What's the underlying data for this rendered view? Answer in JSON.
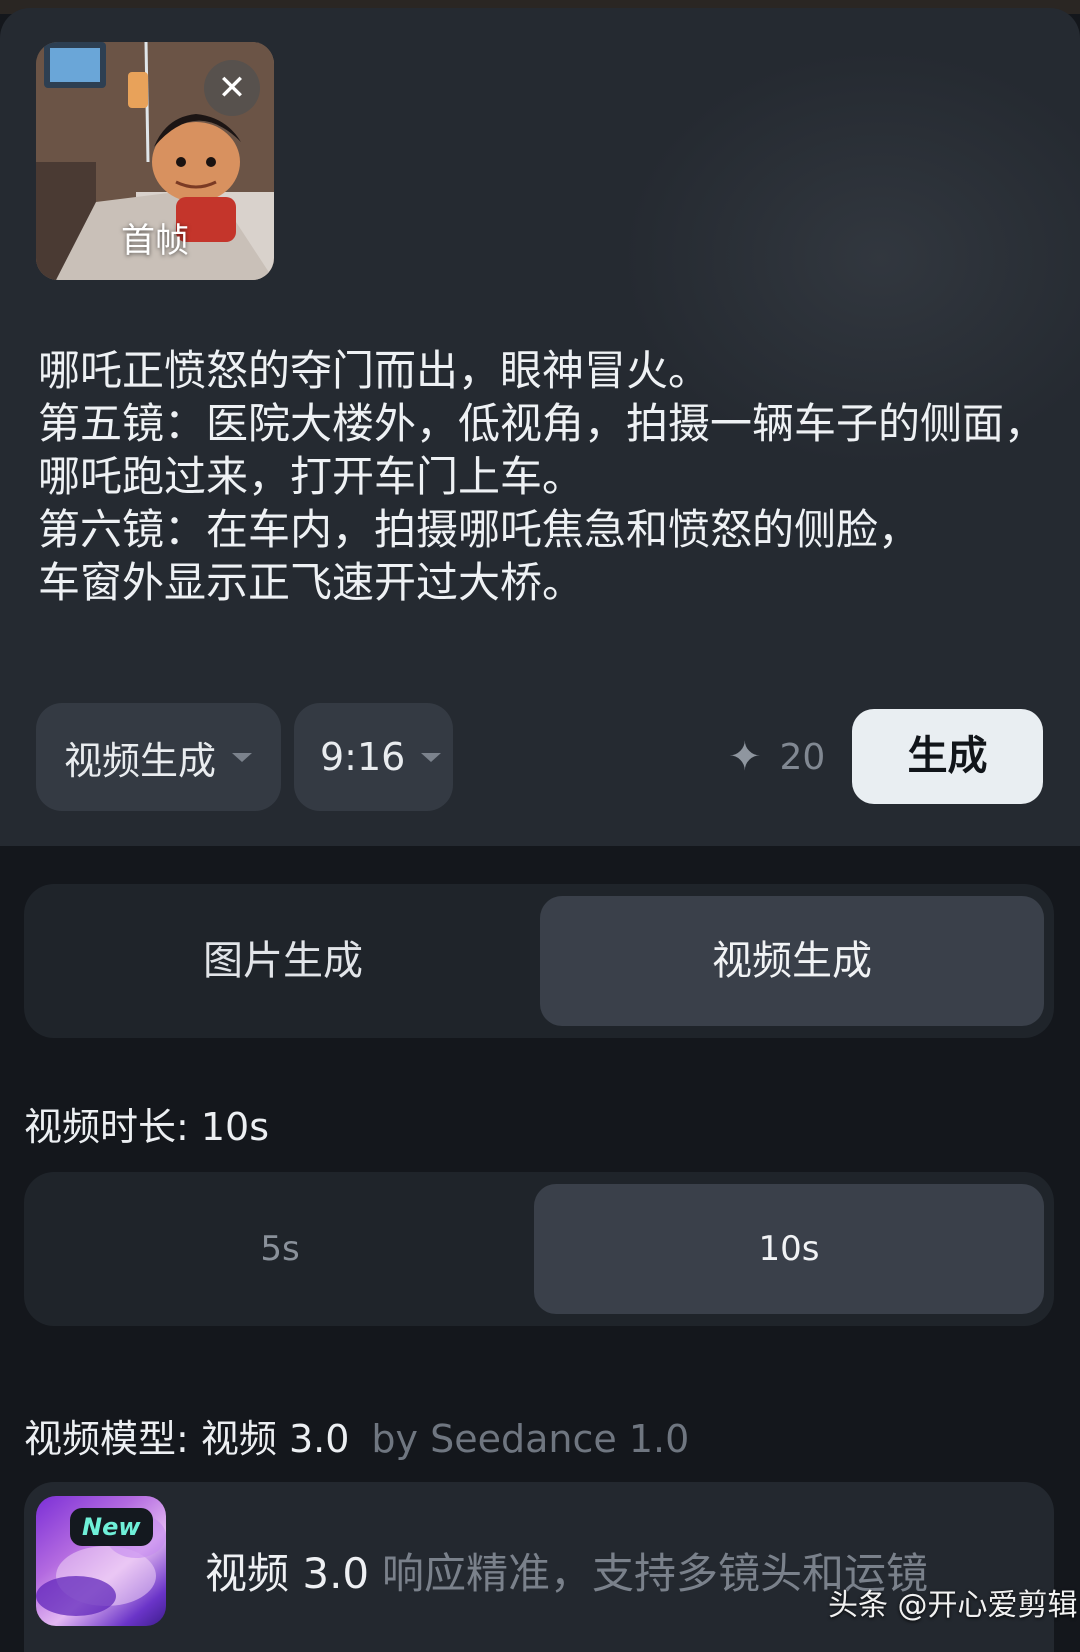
{
  "thumbnail": {
    "label": "首帧"
  },
  "prompt_text": "哪吒正愤怒的夺门而出，眼神冒火。\n第五镜：医院大楼外，低视角，拍摄一辆车子的侧面，\n哪吒跑过来，打开车门上车。\n第六镜：在车内，拍摄哪吒焦急和愤怒的侧脸，\n车窗外显示正飞速开过大桥。",
  "toolbar": {
    "mode_select": "视频生成",
    "ratio_select": "9:16",
    "credits": "20",
    "generate_label": "生成"
  },
  "mode_tabs": [
    {
      "label": "图片生成",
      "active": false
    },
    {
      "label": "视频生成",
      "active": true
    }
  ],
  "duration": {
    "label": "视频时长: 10s",
    "options": [
      {
        "label": "5s",
        "active": false
      },
      {
        "label": "10s",
        "active": true
      }
    ]
  },
  "model": {
    "label": "视频模型: 视频 3.0",
    "sublabel": "by Seedance 1.0",
    "badge": "New",
    "name": "视频 3.0",
    "description": "响应精准，支持多镜头和运镜"
  },
  "watermark": "头条 @开心爱剪辑"
}
